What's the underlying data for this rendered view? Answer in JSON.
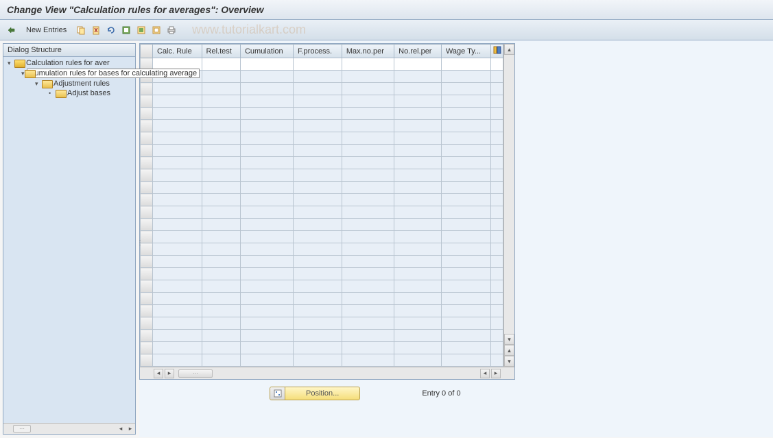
{
  "title": "Change View \"Calculation rules for averages\": Overview",
  "toolbar": {
    "new_entries": "New Entries"
  },
  "watermark": "www.tutorialkart.com",
  "sidebar": {
    "header": "Dialog Structure",
    "tree": {
      "l0": {
        "label": "Calculation rules for aver"
      },
      "l1": {
        "label": "Cumulation rules for bases for calculating average"
      },
      "l2": {
        "label": "Adjustment rules"
      },
      "l3": {
        "label": "Adjust bases"
      }
    }
  },
  "table": {
    "columns": {
      "c1": "Calc. Rule",
      "c2": "Rel.test",
      "c3": "Cumulation",
      "c4": "F.process.",
      "c5": "Max.no.per",
      "c6": "No.rel.per",
      "c7": "Wage Ty..."
    }
  },
  "footer": {
    "position_btn": "Position...",
    "entry_status": "Entry 0 of 0"
  }
}
